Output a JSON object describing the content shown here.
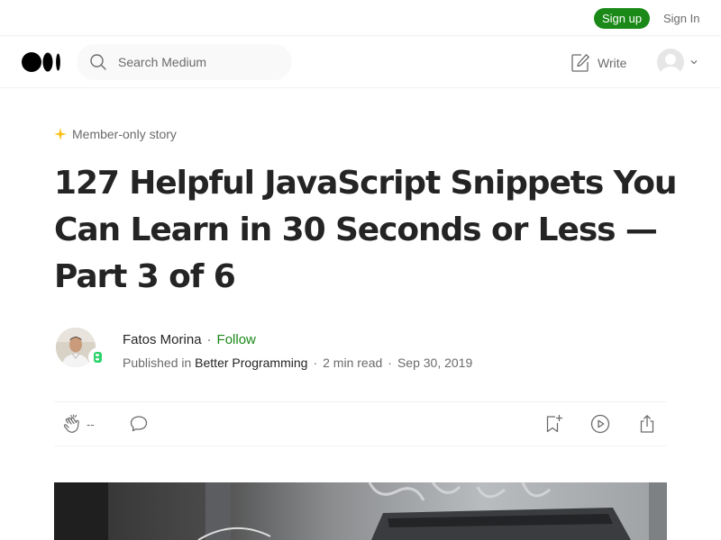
{
  "topbar": {
    "signup_label": "Sign up",
    "signin_label": "Sign In"
  },
  "navbar": {
    "logo_icon": "medium-logo-icon",
    "search_placeholder": "Search Medium",
    "write_label": "Write"
  },
  "article": {
    "member_badge": "Member-only story",
    "title": "127 Helpful JavaScript Snippets You Can Learn in 30 Seconds or Less — Part 3 of 6",
    "author": "Fatos Morina",
    "follow_label": "Follow",
    "published_in_label": "Published in",
    "publication": "Better Programming",
    "read_time": "2 min read",
    "date": "Sep 30, 2019",
    "clap_count": "--"
  },
  "colors": {
    "accent": "#1a8917",
    "text": "#242424",
    "muted": "#6b6b6b",
    "star": "#ffc017"
  }
}
